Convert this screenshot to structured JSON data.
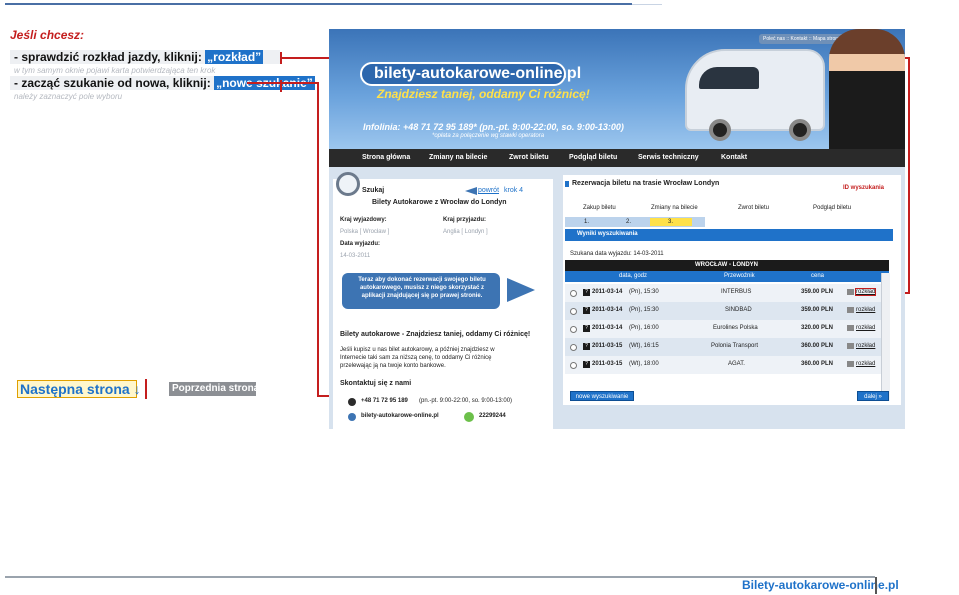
{
  "tutorial": {
    "question": "Jeśli chcesz:",
    "option1": {
      "text_before": "- sprawdzić rozkład jazdy, kliknij: ",
      "highlight": "„rozkład”",
      "hint": "w tym samym oknie pojawi karta potwierdzająca ten krok"
    },
    "option2": {
      "text_before": "- zacząć szukanie od nowa, kliknij: ",
      "highlight": "„nowe szukanie”",
      "hint": "należy zaznaczyć pole wyboru"
    },
    "next_button": "Następna strona ↓",
    "prev_button": "Poprzednia strona ↑",
    "footer_brand": "Bilety-autokarowe-online.pl"
  },
  "site": {
    "top_links": "Poleć nas :: Kontakt :: Mapa strony",
    "logo": "bilety-autokarowe-online.pl",
    "tagline": "Znajdziesz taniej, oddamy Ci różnicę!",
    "infolinia": "Infolinia: +48 71 72 95 189* (pn.-pt. 9:00-22:00, so. 9:00-13:00)",
    "infolinia_note": "*opłata za połączenie wg stawki operatora",
    "menu": [
      "Strona główna",
      "Zmiany na bilecie",
      "Zwrot biletu",
      "Podgląd biletu",
      "Serwis techniczny",
      "Kontakt"
    ]
  },
  "search_panel": {
    "title": "Szukaj",
    "back_link": "powrót",
    "step": "krok 4",
    "subtitle": "Bilety Autokarowe z Wrocław do Londyn",
    "departure_country_label": "Kraj wyjazdowy:",
    "departure_country_value": "Polska [ Wrocław ]",
    "arrival_country_label": "Kraj przyjazdu:",
    "arrival_country_value": "Anglia [ Londyn ]",
    "date_label": "Data wyjazdu:",
    "date_value": "14-03-2011",
    "bubble_lines": [
      "Teraz aby dokonać rezerwacji swojego biletu",
      "autokarowego, musisz z niego skorzystać z",
      "aplikacji znajdującej się po prawej stronie."
    ],
    "promo_title": "Bilety autokarowe - Znajdziesz taniej, oddamy Ci różnicę!",
    "promo_text": [
      "Jeśli kupisz u nas bilet autokarowy, a później znajdziesz w",
      "Internecie taki sam za niższą cenę, to oddamy Ci różnicę",
      "przelewając ją na twoje konto bankowe."
    ],
    "contact_title": "Skontaktuj się z nami",
    "contact_phone": "+48 71 72 95 189",
    "contact_hours": "(pn.-pt. 9:00-22:00, so. 9:00-13:00)",
    "contact_site": "bilety-autokarowe-online.pl",
    "contact_icq": "22299244"
  },
  "reservation": {
    "title": "Rezerwacja biletu na trasie Wrocław Londyn",
    "id_label": "ID wyszukania",
    "tabs": [
      "Zakup biletu",
      "Zmiany na bilecie",
      "Zwrot biletu",
      "Podgląd biletu"
    ],
    "steps": [
      "1.",
      "2.",
      "3."
    ],
    "results_label": "Wyniki wyszukiwania",
    "search_date": "Szukana data wyjazdu: 14-03-2011",
    "route": "WROCŁAW - LONDYN",
    "columns": [
      "data, godz",
      "Przewoźnik",
      "cena"
    ],
    "rows": [
      {
        "date": "2011-03-14",
        "day": "(Pn), 15:30",
        "carrier": "INTERBUS",
        "price": "359.00 PLN",
        "link": "rozkład"
      },
      {
        "date": "2011-03-14",
        "day": "(Pn), 15:30",
        "carrier": "SINDBAD",
        "price": "359.00 PLN",
        "link": "rozkład"
      },
      {
        "date": "2011-03-14",
        "day": "(Pn), 16:00",
        "carrier": "Eurolines Polska",
        "price": "320.00 PLN",
        "link": "rozkład"
      },
      {
        "date": "2011-03-15",
        "day": "(Wt), 16:15",
        "carrier": "Polonia Transport",
        "price": "360.00 PLN",
        "link": "rozkład"
      },
      {
        "date": "2011-03-15",
        "day": "(Wt), 18:00",
        "carrier": "AGAT.",
        "price": "360.00 PLN",
        "link": "rozkład"
      }
    ],
    "new_search_button": "nowe wyszukiwanie",
    "next_button": "dalej »"
  },
  "colors": {
    "accent_red": "#c41e1e",
    "accent_blue": "#1f72c9",
    "highlight_yellow": "#ffe14a"
  }
}
